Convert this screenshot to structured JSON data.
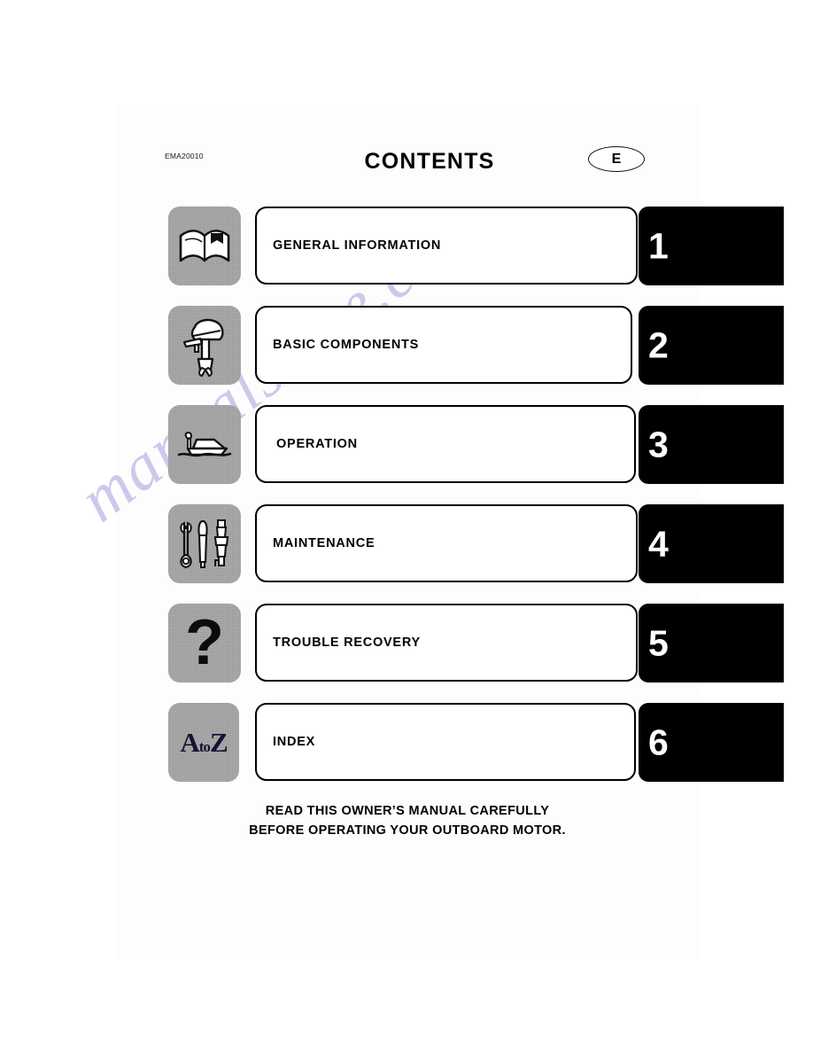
{
  "header": {
    "doc_code": "EMA20010",
    "title": "CONTENTS",
    "language_badge": "E"
  },
  "sections": [
    {
      "number": "1",
      "label": "GENERAL INFORMATION",
      "icon": "open-book-icon"
    },
    {
      "number": "2",
      "label": "BASIC COMPONENTS",
      "icon": "outboard-motor-icon"
    },
    {
      "number": "3",
      "label": "OPERATION",
      "icon": "boat-on-water-icon"
    },
    {
      "number": "4",
      "label": "MAINTENANCE",
      "icon": "wrench-screwdriver-sparkplug-icon"
    },
    {
      "number": "5",
      "label": "TROUBLE RECOVERY",
      "icon": "question-mark-icon"
    },
    {
      "number": "6",
      "label": "INDEX",
      "icon": "a-to-z-icon"
    }
  ],
  "footer": {
    "line1": "READ THIS OWNER’S MANUAL CAREFULLY",
    "line2": "BEFORE OPERATING YOUR OUTBOARD MOTOR."
  },
  "watermark": {
    "text": "manualshive.com"
  },
  "icon_text": {
    "a": "A",
    "to": "to",
    "z": "Z",
    "question": "?"
  },
  "colors": {
    "page_background": "#ffffff",
    "ink": "#000000",
    "icon_tile": "#a9a9a9",
    "tab_background": "#000000",
    "tab_number": "#ffffff",
    "watermark": "#b9b6e6"
  }
}
